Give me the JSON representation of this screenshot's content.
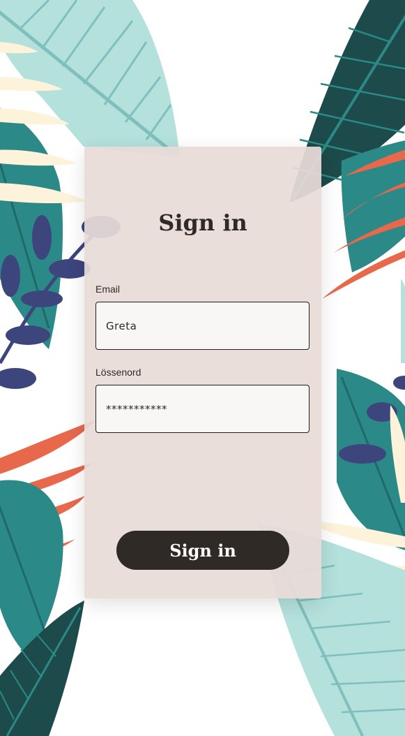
{
  "page": {
    "title": "Sign in"
  },
  "form": {
    "email": {
      "label": "Email",
      "value": "Greta"
    },
    "password": {
      "label": "Lössenord",
      "value": "***********"
    },
    "submit_label": "Sign in"
  },
  "colors": {
    "card": "#e8dbd8",
    "button": "#302a26",
    "leaf_dark": "#1d4a4a",
    "leaf_teal": "#2b8a87",
    "leaf_light": "#b4e1dc",
    "leaf_coral": "#e8684b",
    "leaf_cream": "#fcf3da",
    "leaf_navy": "#3d457d"
  }
}
